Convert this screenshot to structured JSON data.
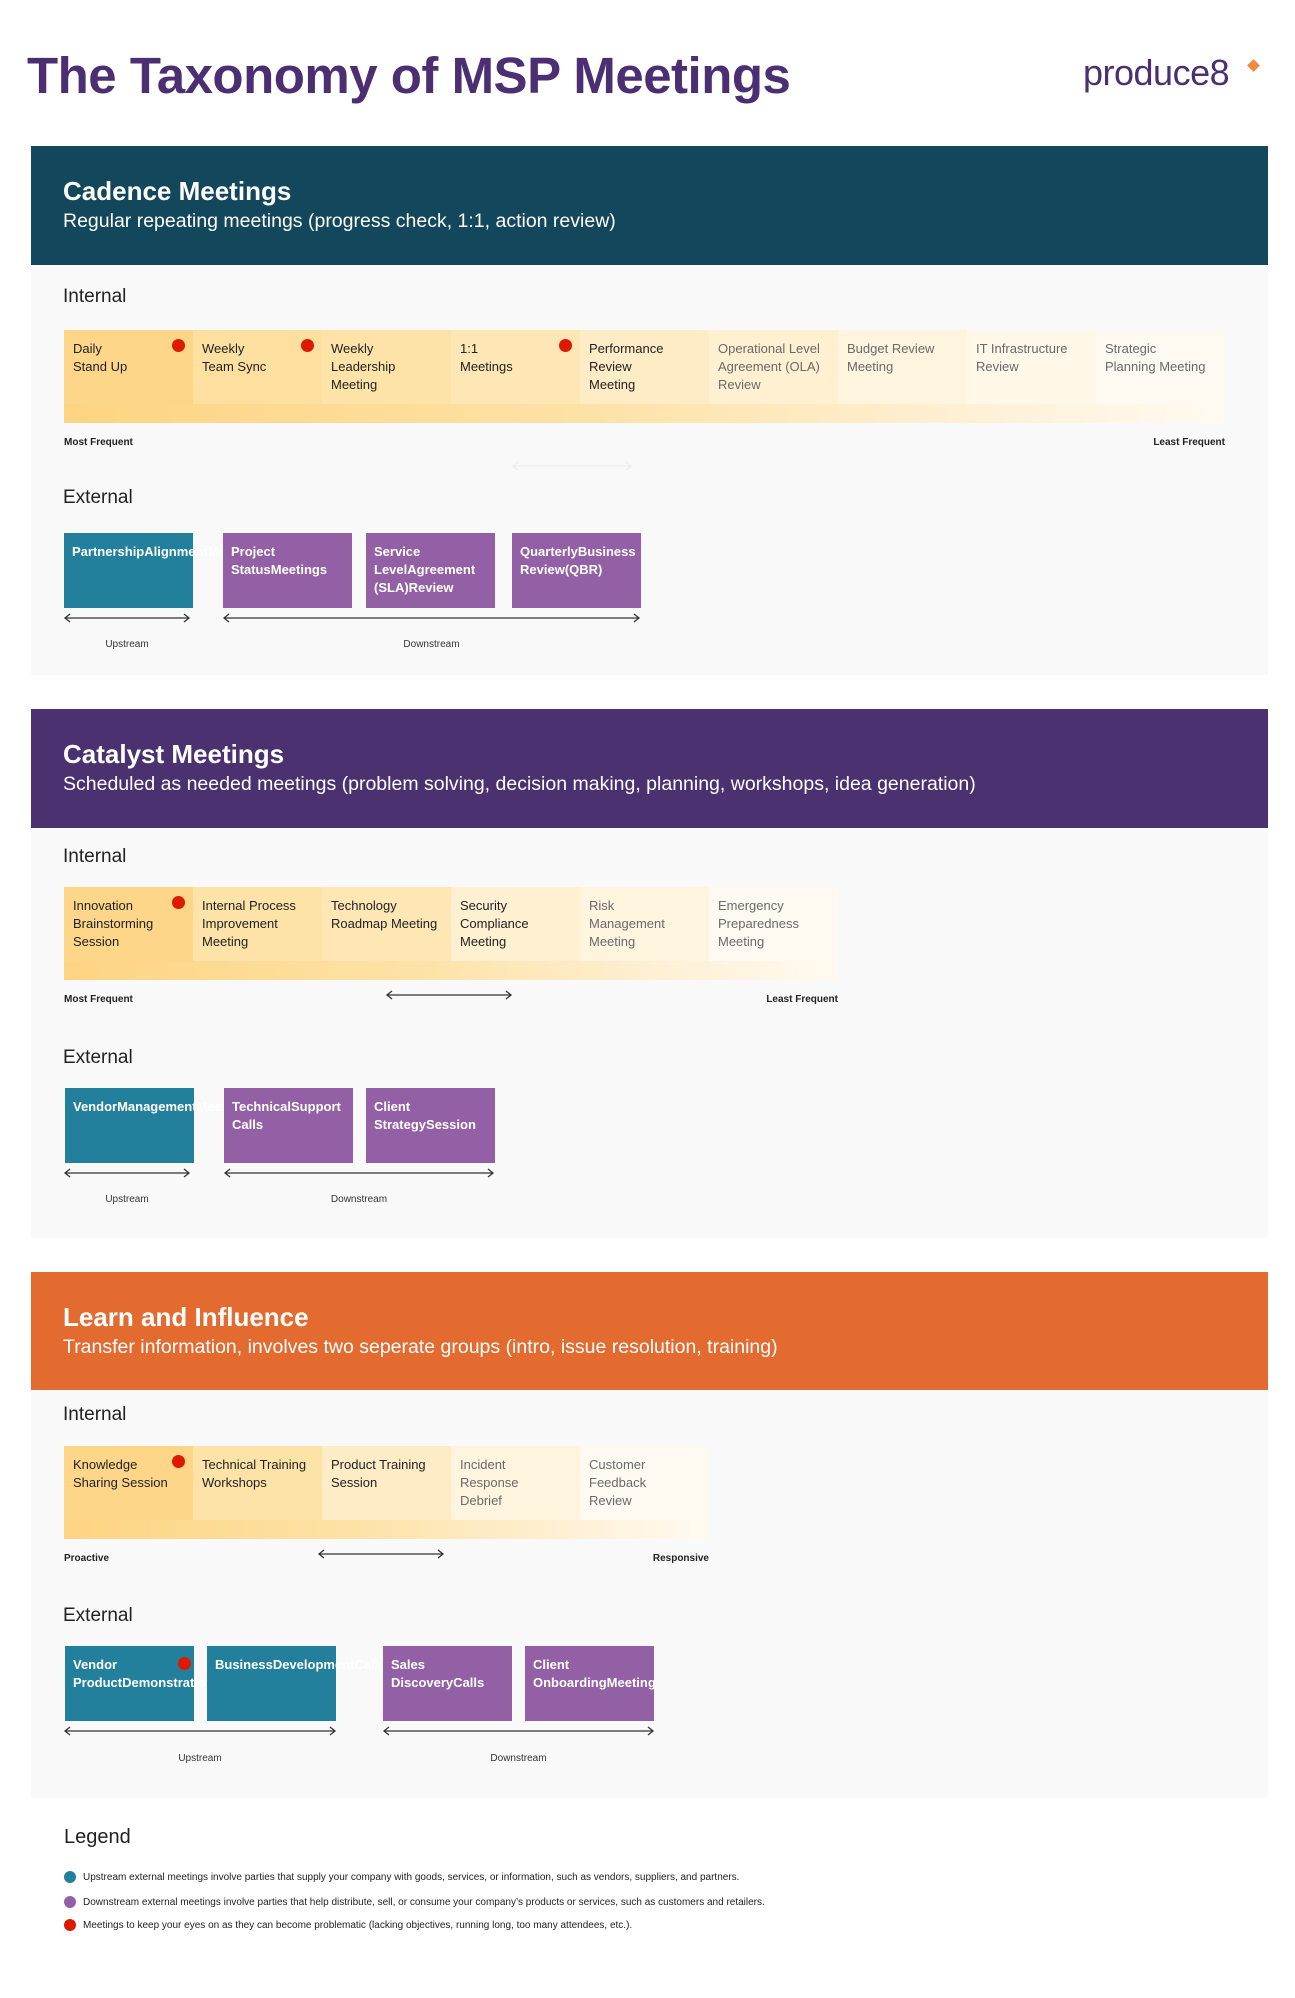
{
  "header": {
    "title": "The Taxonomy of MSP Meetings",
    "logo": "produce8"
  },
  "colors": {
    "cadence": "#13475b",
    "catalyst": "#4b3170",
    "learn": "#e36b30",
    "upstream": "#23809c",
    "downstream": "#9460a5",
    "watch": "#dd1a00",
    "title": "#4b2f72"
  },
  "sections": [
    {
      "title": "Cadence Meetings",
      "subtitle": "Regular repeating meetings (progress check, 1:1, action review)",
      "internal_label": "Internal",
      "internal": [
        {
          "label": "Daily\nStand Up",
          "flag": true
        },
        {
          "label": "Weekly\nTeam Sync",
          "flag": true
        },
        {
          "label": "Weekly\nLeadership\nMeeting",
          "flag": false
        },
        {
          "label": "1:1\nMeetings",
          "flag": true
        },
        {
          "label": "Performance\nReview\nMeeting",
          "flag": false
        },
        {
          "label": "Operational Level\nAgreement (OLA)\nReview",
          "flag": false
        },
        {
          "label": "Budget Review\nMeeting",
          "flag": false
        },
        {
          "label": "IT Infrastructure\nReview",
          "flag": false
        },
        {
          "label": "Strategic\nPlanning Meeting",
          "flag": false
        }
      ],
      "axis_left": "Most Frequent",
      "axis_right": "Least Frequent",
      "external_label": "External",
      "upstream": [
        {
          "label": "Partnership\nAlignment\nMeetings",
          "flag": false
        }
      ],
      "downstream": [
        {
          "label": "Project Status\nMeetings",
          "flag": false
        },
        {
          "label": "Service Level\nAgreement (SLA)\nReview",
          "flag": false
        },
        {
          "label": "Quarterly\nBusiness Review\n(QBR)",
          "flag": false
        }
      ],
      "upstream_label": "Upstream",
      "downstream_label": "Downstream"
    },
    {
      "title": "Catalyst Meetings",
      "subtitle": "Scheduled as needed meetings (problem solving, decision making, planning, workshops, idea generation)",
      "internal_label": "Internal",
      "internal": [
        {
          "label": "Innovation\nBrainstorming\nSession",
          "flag": true
        },
        {
          "label": "Internal Process\nImprovement\nMeeting",
          "flag": false
        },
        {
          "label": "Technology\nRoadmap Meeting",
          "flag": false
        },
        {
          "label": "Security\nCompliance\nMeeting",
          "flag": false
        },
        {
          "label": "Risk\nManagement\nMeeting",
          "flag": false
        },
        {
          "label": "Emergency\nPreparedness\nMeeting",
          "flag": false
        }
      ],
      "axis_left": "Most Frequent",
      "axis_right": "Least Frequent",
      "external_label": "External",
      "upstream": [
        {
          "label": "Vendor\nManagement\nMeeting",
          "flag": false
        }
      ],
      "downstream": [
        {
          "label": "Technical\nSupport Calls",
          "flag": false
        },
        {
          "label": "Client Strategy\nSession",
          "flag": false
        }
      ],
      "upstream_label": "Upstream",
      "downstream_label": "Downstream"
    },
    {
      "title": "Learn and Influence",
      "subtitle": "Transfer information, involves two seperate groups (intro, issue resolution, training)",
      "internal_label": "Internal",
      "internal": [
        {
          "label": "Knowledge\nSharing Session",
          "flag": true
        },
        {
          "label": "Technical Training\nWorkshops",
          "flag": false
        },
        {
          "label": "Product Training\nSession",
          "flag": false
        },
        {
          "label": "Incident\nResponse\nDebrief",
          "flag": false
        },
        {
          "label": "Customer\nFeedback\nReview",
          "flag": false
        }
      ],
      "axis_left": "Proactive",
      "axis_right": "Responsive",
      "external_label": "External",
      "upstream": [
        {
          "label": "Vendor Product\nDemonstrations",
          "flag": true
        },
        {
          "label": "Business\nDevelopment\nCalls",
          "flag": false
        }
      ],
      "downstream": [
        {
          "label": "Sales Discovery\nCalls",
          "flag": false
        },
        {
          "label": "Client Onboarding\nMeeting",
          "flag": false
        }
      ],
      "upstream_label": "Upstream",
      "downstream_label": "Downstream"
    }
  ],
  "legend": {
    "title": "Legend",
    "items": [
      {
        "color": "#23809c",
        "text": "Upstream external meetings involve parties that supply your company with goods, services, or information, such as vendors, suppliers, and partners."
      },
      {
        "color": "#9460a5",
        "text": "Downstream external meetings involve parties that help distribute, sell, or consume your company’s products or services, such as customers and retailers."
      },
      {
        "color": "#dd1a00",
        "text": "Meetings to keep your eyes on as they can become problematic (lacking objectives, running long, too many attendees, etc.)."
      }
    ]
  }
}
